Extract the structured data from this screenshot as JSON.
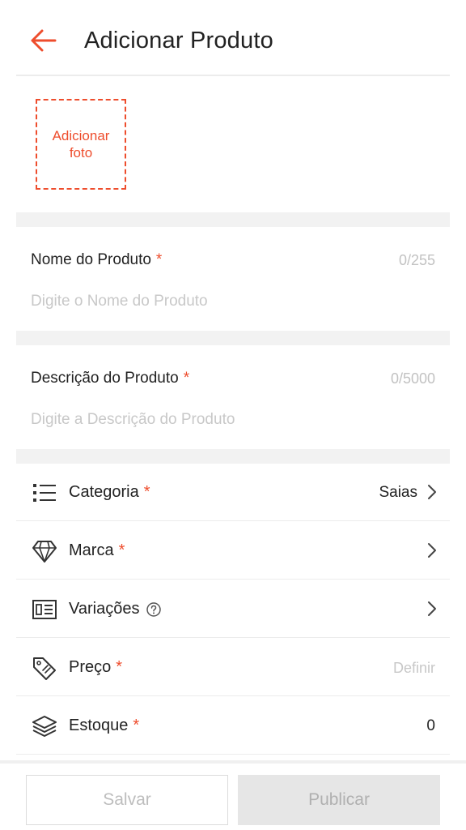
{
  "header": {
    "title": "Adicionar Produto"
  },
  "photo": {
    "add_label": "Adicionar foto"
  },
  "product_name": {
    "label": "Nome do Produto",
    "required_mark": "*",
    "counter": "0/255",
    "placeholder": "Digite o Nome do Produto",
    "value": ""
  },
  "product_description": {
    "label": "Descrição do Produto",
    "required_mark": "*",
    "counter": "0/5000",
    "placeholder": "Digite a Descrição do Produto",
    "value": ""
  },
  "rows": {
    "category": {
      "label": "Categoria",
      "required_mark": "*",
      "value": "Saias",
      "icon": "list-icon"
    },
    "brand": {
      "label": "Marca",
      "required_mark": "*",
      "icon": "diamond-icon"
    },
    "variations": {
      "label": "Variações",
      "icon": "variations-icon",
      "help_icon": "help-circle-icon"
    },
    "price": {
      "label": "Preço",
      "required_mark": "*",
      "value": "Definir",
      "icon": "price-tag-icon"
    },
    "stock": {
      "label": "Estoque",
      "required_mark": "*",
      "value": "0",
      "icon": "layers-icon"
    }
  },
  "actions": {
    "save_label": "Salvar",
    "publish_label": "Publicar"
  },
  "colors": {
    "accent": "#ee4d2d",
    "separator": "#f2f2f2",
    "disabled_bg": "#e6e6e6",
    "placeholder": "#c8c8c8"
  }
}
